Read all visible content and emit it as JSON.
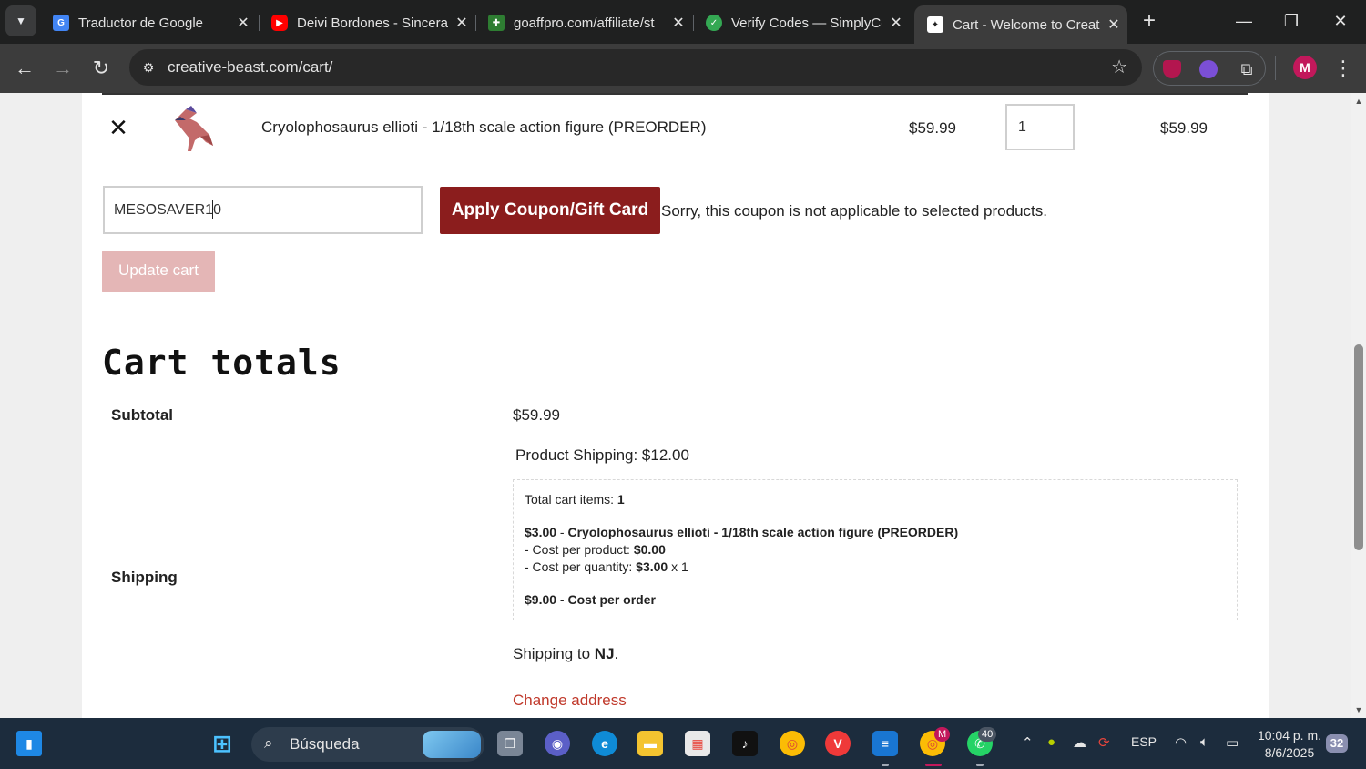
{
  "browser": {
    "tabs": [
      {
        "title": "Traductor de Google",
        "favicon": "google-translate-icon",
        "color": "#4285f4"
      },
      {
        "title": "Deivi Bordones - Sincera",
        "favicon": "youtube-icon",
        "color": "#ff0000"
      },
      {
        "title": "goaffpro.com/affiliate/st",
        "favicon": "puzzle-icon",
        "color": "#2e7d32"
      },
      {
        "title": "Verify Codes — SimplyCo",
        "favicon": "check-icon",
        "color": "#34a853"
      },
      {
        "title": "Cart - Welcome to Creati",
        "favicon": "site-icon",
        "color": "#ffffff"
      }
    ],
    "url": "creative-beast.com/cart/",
    "profile_initial": "M"
  },
  "cart": {
    "item": {
      "name": "Cryolophosaurus ellioti - 1/18th scale action figure (PREORDER)",
      "price": "$59.99",
      "quantity": "1",
      "subtotal": "$59.99"
    },
    "coupon": {
      "value": "MESOSAVER10",
      "apply_label": "Apply Coupon/Gift Card",
      "message": "Sorry, this coupon is not applicable to selected products."
    },
    "update_label": "Update cart"
  },
  "totals": {
    "title": "Cart totals",
    "subtotal_label": "Subtotal",
    "subtotal_value": "$59.99",
    "shipping_label": "Shipping",
    "product_shipping": "Product Shipping: $12.00",
    "breakdown": {
      "items_label": "Total cart items:",
      "items_count": "1",
      "line_price": "$3.00",
      "line_sep": " - ",
      "line_product": "Cryolophosaurus ellioti - 1/18th scale action figure (PREORDER)",
      "cpp_label": "- Cost per product:",
      "cpp_value": "$0.00",
      "cpq_label": "- Cost per quantity:",
      "cpq_value": "$3.00",
      "cpq_suffix": " x 1",
      "order_price": "$9.00",
      "order_label": "Cost per order"
    },
    "ship_to_prefix": "Shipping to ",
    "ship_to_state": "NJ",
    "ship_to_suffix": ".",
    "change_address": "Change address"
  },
  "taskbar": {
    "search_label": "Búsqueda",
    "chrome_badge": "M",
    "whatsapp_badge": "40",
    "language": "ESP",
    "time": "10:04 p. m.",
    "date": "8/6/2025",
    "notifications": "32"
  },
  "colors": {
    "accent": "#8b1d1d",
    "error_link": "#c0392b",
    "update_disabled": "#e4b6b6"
  }
}
